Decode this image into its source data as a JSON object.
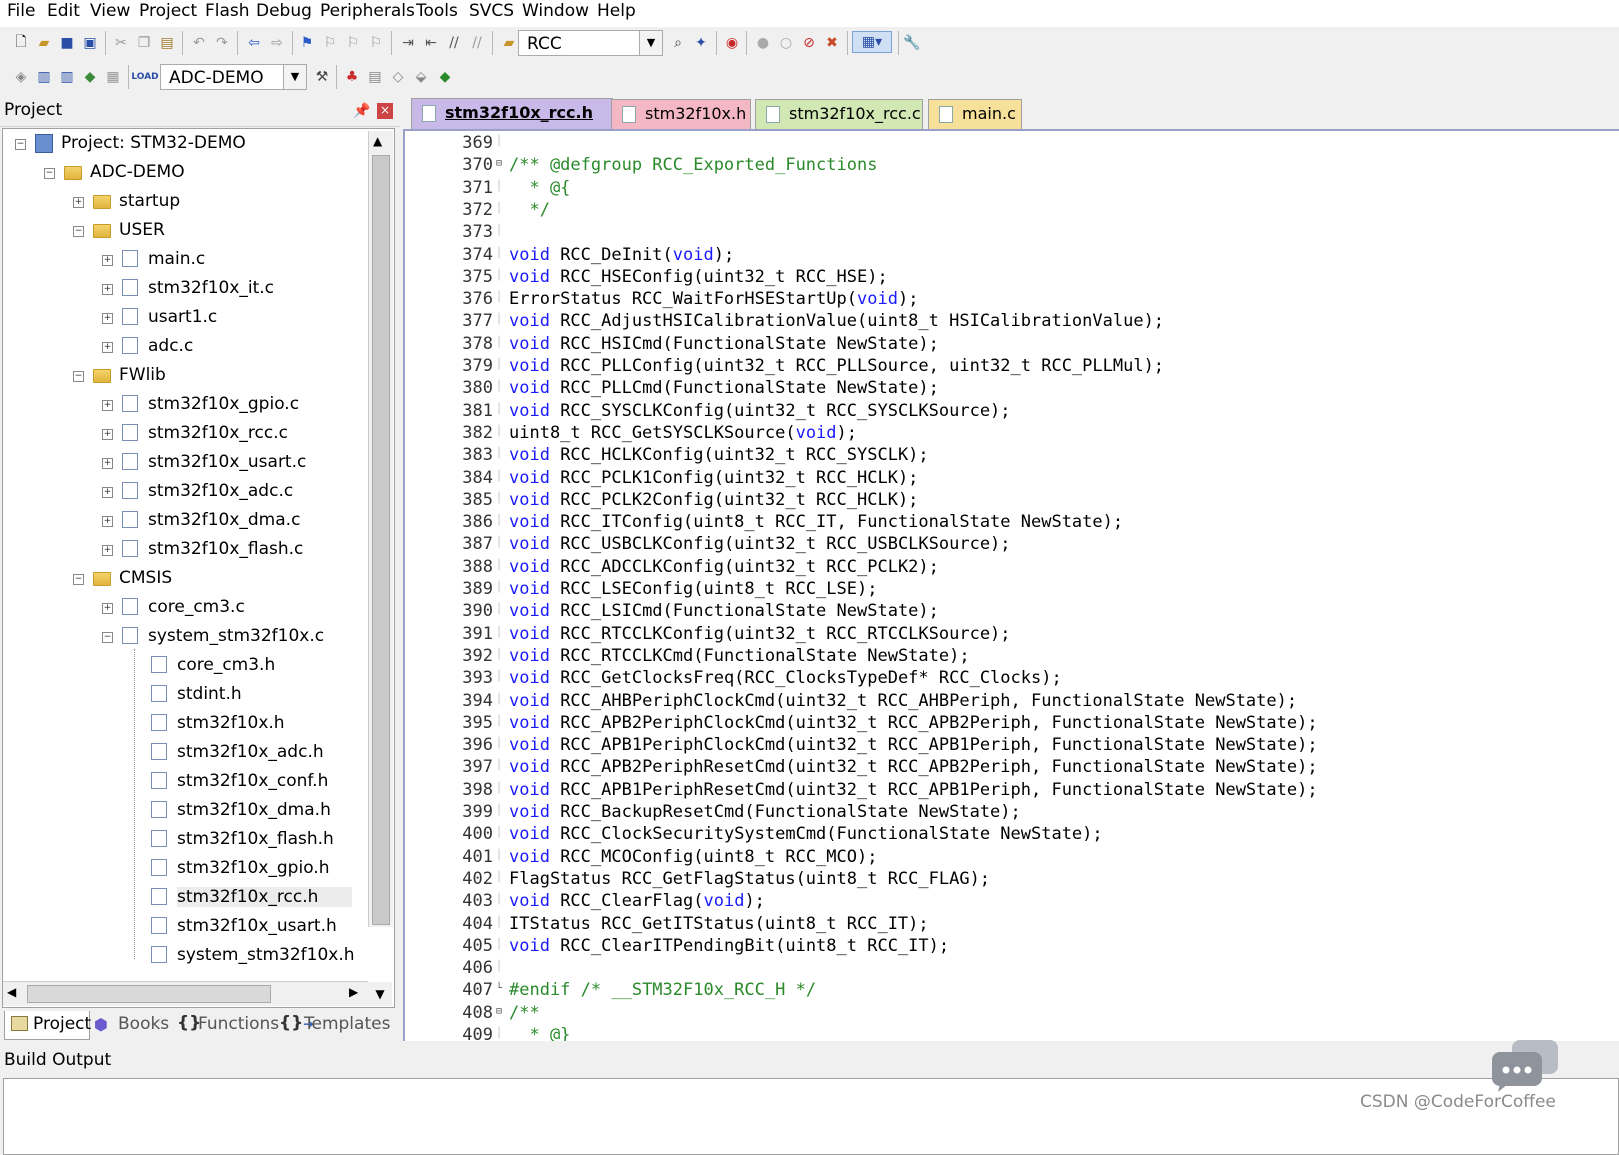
{
  "menu": [
    "File",
    "Edit",
    "View",
    "Project",
    "Flash",
    "Debug",
    "Peripherals",
    "Tools",
    "SVCS",
    "Window",
    "Help"
  ],
  "toolbar1": {
    "find_combo_value": "RCC"
  },
  "toolbar2": {
    "target_combo_value": "ADC-DEMO"
  },
  "project_panel": {
    "title": "Project",
    "tree": [
      {
        "label": "Project: STM32-DEMO",
        "icon": "project-icon"
      },
      {
        "label": "ADC-DEMO",
        "icon": "target-folder-icon"
      },
      {
        "label": "startup",
        "icon": "folder-icon"
      },
      {
        "label": "USER",
        "icon": "folder-icon"
      },
      {
        "label": "main.c",
        "icon": "file-icon"
      },
      {
        "label": "stm32f10x_it.c",
        "icon": "file-icon"
      },
      {
        "label": "usart1.c",
        "icon": "file-icon"
      },
      {
        "label": "adc.c",
        "icon": "file-icon"
      },
      {
        "label": "FWlib",
        "icon": "folder-icon"
      },
      {
        "label": "stm32f10x_gpio.c",
        "icon": "file-icon"
      },
      {
        "label": "stm32f10x_rcc.c",
        "icon": "file-icon"
      },
      {
        "label": "stm32f10x_usart.c",
        "icon": "file-icon"
      },
      {
        "label": "stm32f10x_adc.c",
        "icon": "file-icon"
      },
      {
        "label": "stm32f10x_dma.c",
        "icon": "file-icon"
      },
      {
        "label": "stm32f10x_flash.c",
        "icon": "file-icon"
      },
      {
        "label": "CMSIS",
        "icon": "folder-icon"
      },
      {
        "label": "core_cm3.c",
        "icon": "file-icon"
      },
      {
        "label": "system_stm32f10x.c",
        "icon": "file-icon"
      },
      {
        "label": "core_cm3.h",
        "icon": "header-file-icon"
      },
      {
        "label": "stdint.h",
        "icon": "header-file-icon"
      },
      {
        "label": "stm32f10x.h",
        "icon": "header-file-icon"
      },
      {
        "label": "stm32f10x_adc.h",
        "icon": "header-file-icon"
      },
      {
        "label": "stm32f10x_conf.h",
        "icon": "header-file-icon"
      },
      {
        "label": "stm32f10x_dma.h",
        "icon": "header-file-icon"
      },
      {
        "label": "stm32f10x_flash.h",
        "icon": "header-file-icon"
      },
      {
        "label": "stm32f10x_gpio.h",
        "icon": "header-file-icon"
      },
      {
        "label": "stm32f10x_rcc.h",
        "icon": "header-file-icon",
        "selected": true
      },
      {
        "label": "stm32f10x_usart.h",
        "icon": "header-file-icon"
      },
      {
        "label": "system_stm32f10x.h",
        "icon": "header-file-icon"
      }
    ],
    "tabs": [
      {
        "label": "Project",
        "active": true
      },
      {
        "label": "Books"
      },
      {
        "label": "Functions"
      },
      {
        "label": "Templates"
      }
    ]
  },
  "editor_tabs": [
    {
      "label": "stm32f10x_rcc.h",
      "active": true,
      "color": "#c9b9e8"
    },
    {
      "label": "stm32f10x.h",
      "color": "#f4b8c4"
    },
    {
      "label": "stm32f10x_rcc.c",
      "color": "#d2e8b4"
    },
    {
      "label": "main.c",
      "color": "#f7e19a"
    }
  ],
  "code_lines": [
    {
      "n": "369",
      "t": ""
    },
    {
      "n": "370",
      "t": "/** @defgroup RCC_Exported_Functions",
      "fold": "minus"
    },
    {
      "n": "371",
      "t": "  * @{"
    },
    {
      "n": "372",
      "t": "  */"
    },
    {
      "n": "373",
      "t": ""
    },
    {
      "n": "374",
      "t": "void RCC_DeInit(void);"
    },
    {
      "n": "375",
      "t": "void RCC_HSEConfig(uint32_t RCC_HSE);"
    },
    {
      "n": "376",
      "t": "ErrorStatus RCC_WaitForHSEStartUp(void);"
    },
    {
      "n": "377",
      "t": "void RCC_AdjustHSICalibrationValue(uint8_t HSICalibrationValue);"
    },
    {
      "n": "378",
      "t": "void RCC_HSICmd(FunctionalState NewState);"
    },
    {
      "n": "379",
      "t": "void RCC_PLLConfig(uint32_t RCC_PLLSource, uint32_t RCC_PLLMul);"
    },
    {
      "n": "380",
      "t": "void RCC_PLLCmd(FunctionalState NewState);"
    },
    {
      "n": "381",
      "t": "void RCC_SYSCLKConfig(uint32_t RCC_SYSCLKSource);"
    },
    {
      "n": "382",
      "t": "uint8_t RCC_GetSYSCLKSource(void);"
    },
    {
      "n": "383",
      "t": "void RCC_HCLKConfig(uint32_t RCC_SYSCLK);"
    },
    {
      "n": "384",
      "t": "void RCC_PCLK1Config(uint32_t RCC_HCLK);"
    },
    {
      "n": "385",
      "t": "void RCC_PCLK2Config(uint32_t RCC_HCLK);"
    },
    {
      "n": "386",
      "t": "void RCC_ITConfig(uint8_t RCC_IT, FunctionalState NewState);"
    },
    {
      "n": "387",
      "t": "void RCC_USBCLKConfig(uint32_t RCC_USBCLKSource);"
    },
    {
      "n": "388",
      "t": "void RCC_ADCCLKConfig(uint32_t RCC_PCLK2);"
    },
    {
      "n": "389",
      "t": "void RCC_LSEConfig(uint8_t RCC_LSE);"
    },
    {
      "n": "390",
      "t": "void RCC_LSICmd(FunctionalState NewState);"
    },
    {
      "n": "391",
      "t": "void RCC_RTCCLKConfig(uint32_t RCC_RTCCLKSource);"
    },
    {
      "n": "392",
      "t": "void RCC_RTCCLKCmd(FunctionalState NewState);"
    },
    {
      "n": "393",
      "t": "void RCC_GetClocksFreq(RCC_ClocksTypeDef* RCC_Clocks);"
    },
    {
      "n": "394",
      "t": "void RCC_AHBPeriphClockCmd(uint32_t RCC_AHBPeriph, FunctionalState NewState);"
    },
    {
      "n": "395",
      "t": "void RCC_APB2PeriphClockCmd(uint32_t RCC_APB2Periph, FunctionalState NewState);"
    },
    {
      "n": "396",
      "t": "void RCC_APB1PeriphClockCmd(uint32_t RCC_APB1Periph, FunctionalState NewState);"
    },
    {
      "n": "397",
      "t": "void RCC_APB2PeriphResetCmd(uint32_t RCC_APB2Periph, FunctionalState NewState);"
    },
    {
      "n": "398",
      "t": "void RCC_APB1PeriphResetCmd(uint32_t RCC_APB1Periph, FunctionalState NewState);"
    },
    {
      "n": "399",
      "t": "void RCC_BackupResetCmd(FunctionalState NewState);"
    },
    {
      "n": "400",
      "t": "void RCC_ClockSecuritySystemCmd(FunctionalState NewState);"
    },
    {
      "n": "401",
      "t": "void RCC_MCOConfig(uint8_t RCC_MCO);"
    },
    {
      "n": "402",
      "t": "FlagStatus RCC_GetFlagStatus(uint8_t RCC_FLAG);"
    },
    {
      "n": "403",
      "t": "void RCC_ClearFlag(void);"
    },
    {
      "n": "404",
      "t": "ITStatus RCC_GetITStatus(uint8_t RCC_IT);"
    },
    {
      "n": "405",
      "t": "void RCC_ClearITPendingBit(uint8_t RCC_IT);"
    },
    {
      "n": "406",
      "t": ""
    },
    {
      "n": "407",
      "t": "#endif /* __STM32F10x_RCC_H */",
      "fold": "end"
    },
    {
      "n": "408",
      "t": "/**",
      "fold": "minus"
    },
    {
      "n": "409",
      "t": "  * @}"
    }
  ],
  "build_output": {
    "title": "Build Output"
  },
  "watermark": "CSDN @CodeForCoffee"
}
